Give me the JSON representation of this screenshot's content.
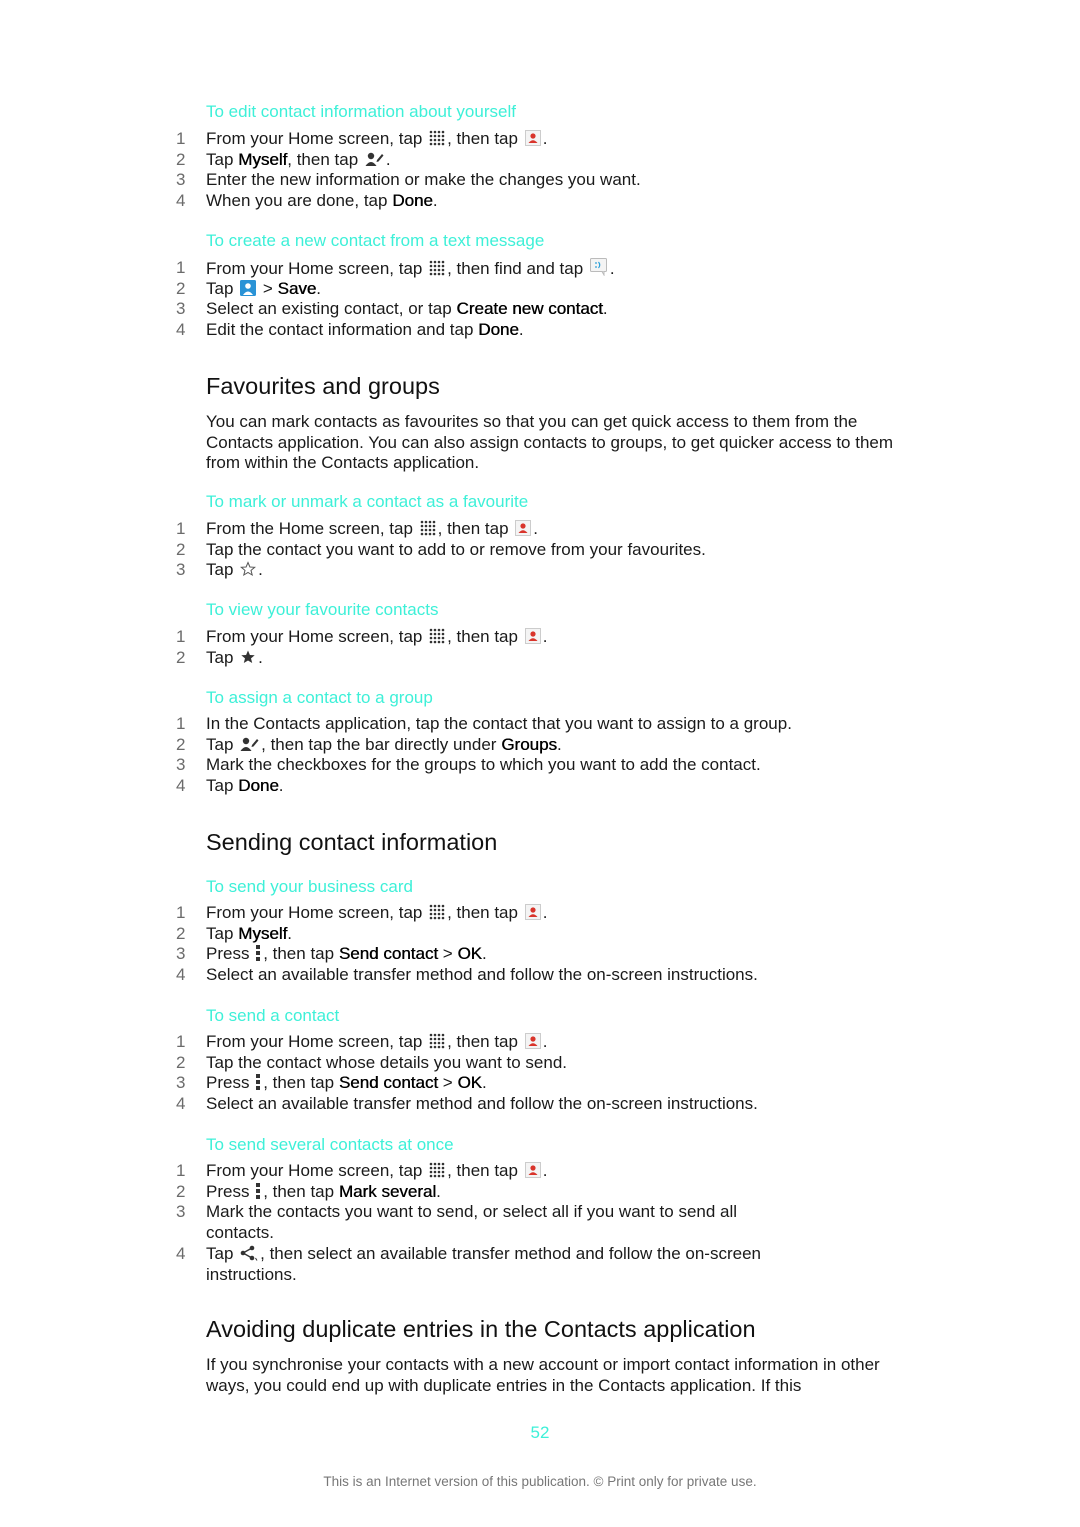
{
  "sections": [
    {
      "title": "To edit contact information about yourself",
      "steps": [
        {
          "num": "1",
          "a": "From your Home screen, tap ",
          "b": ", then tap ",
          "c": "."
        },
        {
          "num": "2",
          "a": "Tap ",
          "bold1": "Myself",
          "b": ", then tap ",
          "c": "."
        },
        {
          "num": "3",
          "a": "Enter the new information or make the changes you want."
        },
        {
          "num": "4",
          "a": "When you are done, tap ",
          "bold1": "Done",
          "c": "."
        }
      ]
    },
    {
      "title": "To create a new contact from a text message",
      "steps": [
        {
          "num": "1",
          "a": "From your Home screen, tap ",
          "b": ", then find and tap ",
          "c": "."
        },
        {
          "num": "2",
          "a": "Tap ",
          "b": " > ",
          "bold1": "Save",
          "c": "."
        },
        {
          "num": "3",
          "a": "Select an existing contact, or tap ",
          "bold1": "Create new contact",
          "c": "."
        },
        {
          "num": "4",
          "a": "Edit the contact information and tap ",
          "bold1": "Done",
          "c": "."
        }
      ]
    },
    {
      "heading": "Favourites and groups",
      "paragraph": "You can mark contacts as favourites so that you can get quick access to them from the Contacts application. You can also assign contacts to groups, to get quicker access to them from within the Contacts application."
    },
    {
      "title": "To mark or unmark a contact as a favourite",
      "steps": [
        {
          "num": "1",
          "a": "From the Home screen, tap ",
          "b": ", then tap ",
          "c": "."
        },
        {
          "num": "2",
          "a": "Tap the contact you want to add to or remove from your favourites."
        },
        {
          "num": "3",
          "a": "Tap ",
          "c": "."
        }
      ]
    },
    {
      "title": "To view your favourite contacts",
      "steps": [
        {
          "num": "1",
          "a": "From your Home screen, tap ",
          "b": ", then tap ",
          "c": "."
        },
        {
          "num": "2",
          "a": "Tap ",
          "c": "."
        }
      ]
    },
    {
      "title": "To assign a contact to a group",
      "steps": [
        {
          "num": "1",
          "a": "In the Contacts application, tap the contact that you want to assign to a group."
        },
        {
          "num": "2",
          "a": "Tap ",
          "b": ", then tap the bar directly under ",
          "bold1": "Groups",
          "c": "."
        },
        {
          "num": "3",
          "a": "Mark the checkboxes for the groups to which you want to add the contact."
        },
        {
          "num": "4",
          "a": "Tap ",
          "bold1": "Done",
          "c": "."
        }
      ]
    },
    {
      "heading": "Sending contact information"
    },
    {
      "title": "To send your business card",
      "steps": [
        {
          "num": "1",
          "a": "From your Home screen, tap ",
          "b": ", then tap ",
          "c": "."
        },
        {
          "num": "2",
          "a": "Tap ",
          "bold1": "Myself",
          "c": "."
        },
        {
          "num": "3",
          "a": "Press ",
          "b": ", then tap ",
          "bold1": "Send contact",
          "gt": " > ",
          "bold2": "OK",
          "c": "."
        },
        {
          "num": "4",
          "a": "Select an available transfer method and follow the on-screen instructions."
        }
      ]
    },
    {
      "title": "To send a contact",
      "steps": [
        {
          "num": "1",
          "a": "From your Home screen, tap ",
          "b": ", then tap ",
          "c": "."
        },
        {
          "num": "2",
          "a": "Tap the contact whose details you want to send."
        },
        {
          "num": "3",
          "a": "Press ",
          "b": ", then tap ",
          "bold1": "Send contact",
          "gt": " > ",
          "bold2": "OK",
          "c": "."
        },
        {
          "num": "4",
          "a": "Select an available transfer method and follow the on-screen instructions."
        }
      ]
    },
    {
      "title": "To send several contacts at once",
      "steps": [
        {
          "num": "1",
          "a": "From your Home screen, tap ",
          "b": ", then tap ",
          "c": "."
        },
        {
          "num": "2",
          "a": "Press ",
          "b": ", then tap ",
          "bold1": "Mark several",
          "c": "."
        },
        {
          "num": "3",
          "a": "Mark the contacts you want to send, or select all if you want to send all contacts."
        },
        {
          "num": "4",
          "a": "Tap ",
          "b": ", then select an available transfer method and follow the on-screen instructions."
        }
      ]
    },
    {
      "heading": "Avoiding duplicate entries in the Contacts application",
      "paragraph": "If you synchronise your contacts with a new account or import contact information in other ways, you could end up with duplicate entries in the Contacts application. If this"
    }
  ],
  "page_number": "52",
  "footer": "This is an Internet version of this publication. © Print only for private use.",
  "colors": {
    "accent": "#3ef0d8",
    "text": "#1a1a1a",
    "step_number": "#6b6b6b",
    "footer": "#777777"
  }
}
